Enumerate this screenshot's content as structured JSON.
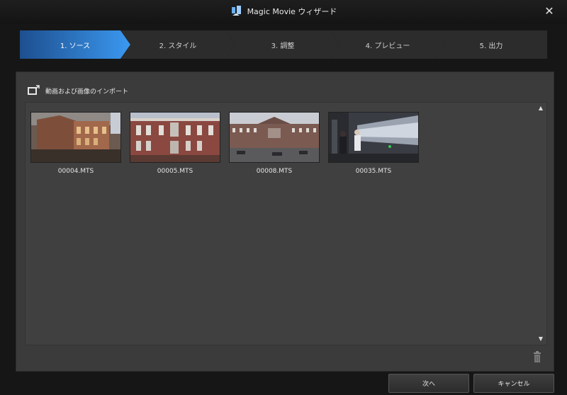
{
  "window": {
    "title": "Magic Movie ウィザード",
    "close_glyph": "✕"
  },
  "steps": [
    {
      "label": "1. ソース",
      "active": true
    },
    {
      "label": "2. スタイル",
      "active": false
    },
    {
      "label": "3. 調整",
      "active": false
    },
    {
      "label": "4. プレビュー",
      "active": false
    },
    {
      "label": "5. 出力",
      "active": false
    }
  ],
  "import_section": {
    "title": "動画および画像のインポート",
    "icon": "import-media-icon"
  },
  "media": [
    {
      "filename": "00004.MTS"
    },
    {
      "filename": "00005.MTS"
    },
    {
      "filename": "00008.MTS"
    },
    {
      "filename": "00035.MTS"
    }
  ],
  "scroll": {
    "up": "▲",
    "down": "▼"
  },
  "buttons": {
    "next": "次へ",
    "cancel": "キャンセル"
  },
  "colors": {
    "accent": "#2d7fd6",
    "background": "#161616",
    "panel": "#3b3b3b"
  }
}
